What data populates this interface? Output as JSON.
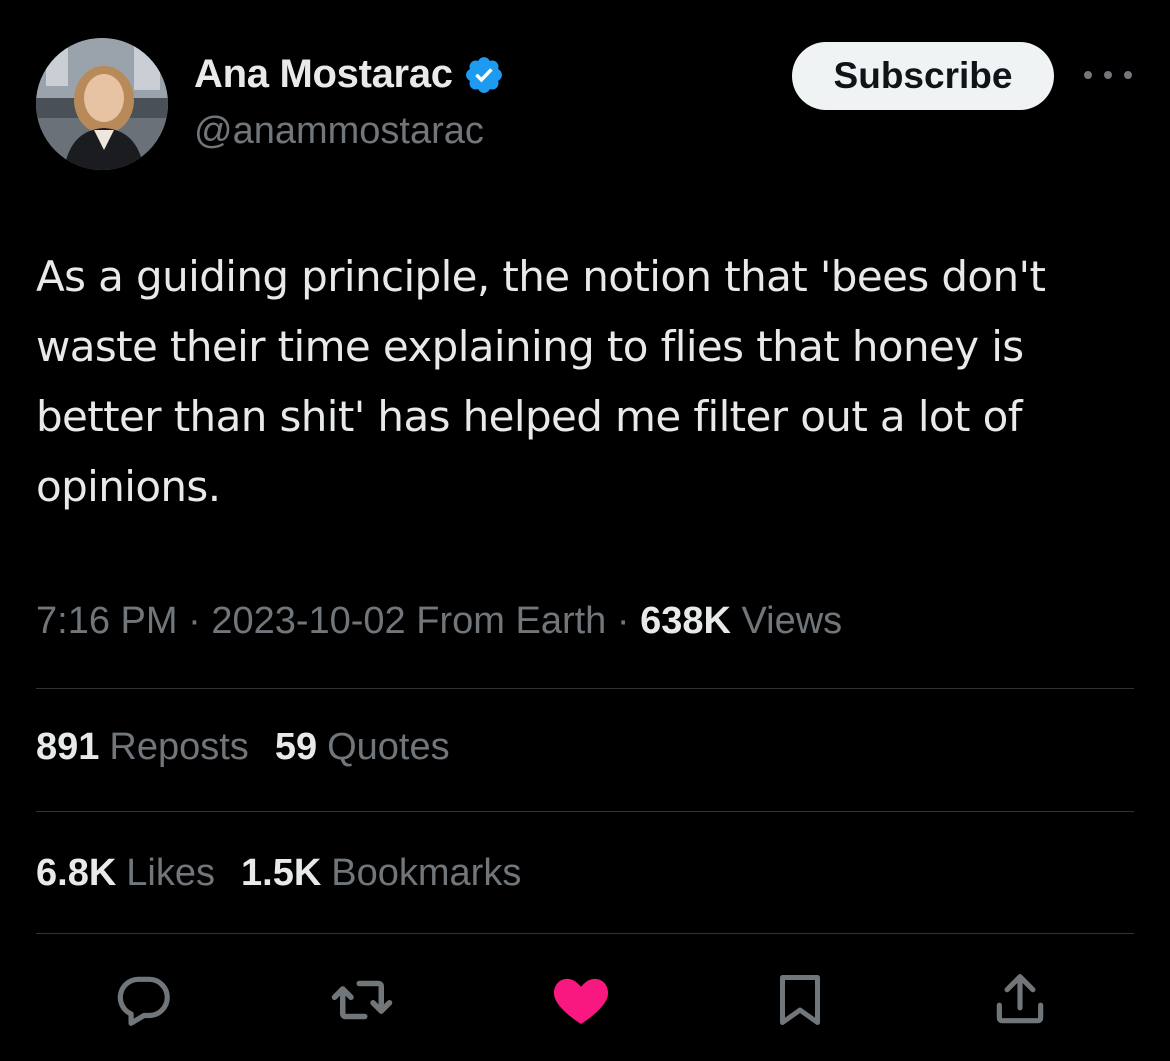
{
  "author": {
    "display_name": "Ana Mostarac",
    "handle": "@anammostarac",
    "verified": true,
    "verified_color": "#1d9bf0"
  },
  "header": {
    "subscribe_label": "Subscribe",
    "more_icon": "more-horizontal-icon"
  },
  "tweet": {
    "text": "As a guiding principle, the notion that 'bees don't waste their time explaining to flies that honey is better than shit' has helped me filter out a lot of opinions."
  },
  "meta": {
    "time": "7:16 PM",
    "separator": "·",
    "date": "2023-10-02",
    "source": "From Earth",
    "views_count": "638K",
    "views_label": "Views"
  },
  "stats": {
    "reposts_count": "891",
    "reposts_label": "Reposts",
    "quotes_count": "59",
    "quotes_label": "Quotes",
    "likes_count": "6.8K",
    "likes_label": "Likes",
    "bookmarks_count": "1.5K",
    "bookmarks_label": "Bookmarks"
  },
  "actions": [
    {
      "icon": "reply-icon"
    },
    {
      "icon": "repost-icon"
    },
    {
      "icon": "like-icon",
      "active": true,
      "color": "#f91880"
    },
    {
      "icon": "bookmark-icon"
    },
    {
      "icon": "share-icon"
    }
  ],
  "colors": {
    "background": "#000000",
    "primary_text": "#e7e9ea",
    "secondary_text": "#71767b",
    "divider": "#2f3336",
    "like_active": "#f91880"
  }
}
